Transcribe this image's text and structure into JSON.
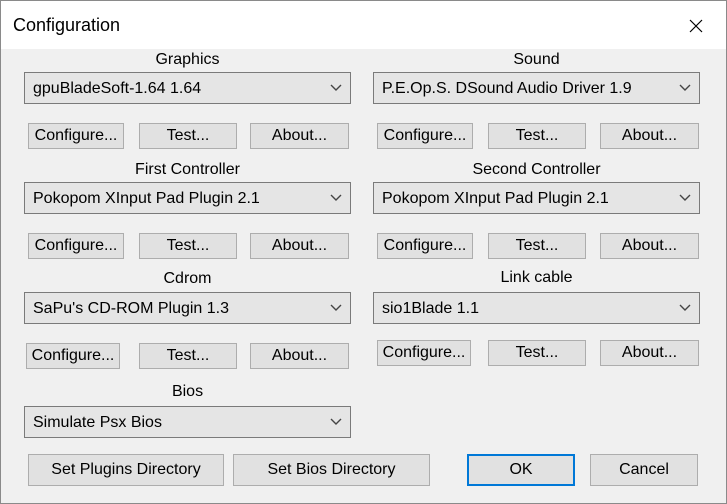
{
  "window": {
    "title": "Configuration"
  },
  "groups": {
    "graphics": {
      "label": "Graphics",
      "selected": "gpuBladeSoft-1.64 1.64"
    },
    "sound": {
      "label": "Sound",
      "selected": "P.E.Op.S. DSound Audio Driver 1.9"
    },
    "first_controller": {
      "label": "First Controller",
      "selected": "Pokopom XInput Pad Plugin 2.1"
    },
    "second_controller": {
      "label": "Second Controller",
      "selected": "Pokopom XInput Pad Plugin 2.1"
    },
    "cdrom": {
      "label": "Cdrom",
      "selected": "SaPu's CD-ROM Plugin 1.3"
    },
    "link_cable": {
      "label": "Link cable",
      "selected": "sio1Blade 1.1"
    },
    "bios": {
      "label": "Bios",
      "selected": "Simulate Psx Bios"
    }
  },
  "buttons": {
    "configure": "Configure...",
    "test": "Test...",
    "about": "About...",
    "set_plugins_dir": "Set Plugins Directory",
    "set_bios_dir": "Set Bios Directory",
    "ok": "OK",
    "cancel": "Cancel"
  },
  "icons": {
    "close": "close-icon",
    "dropdown": "chevron-down-icon"
  }
}
